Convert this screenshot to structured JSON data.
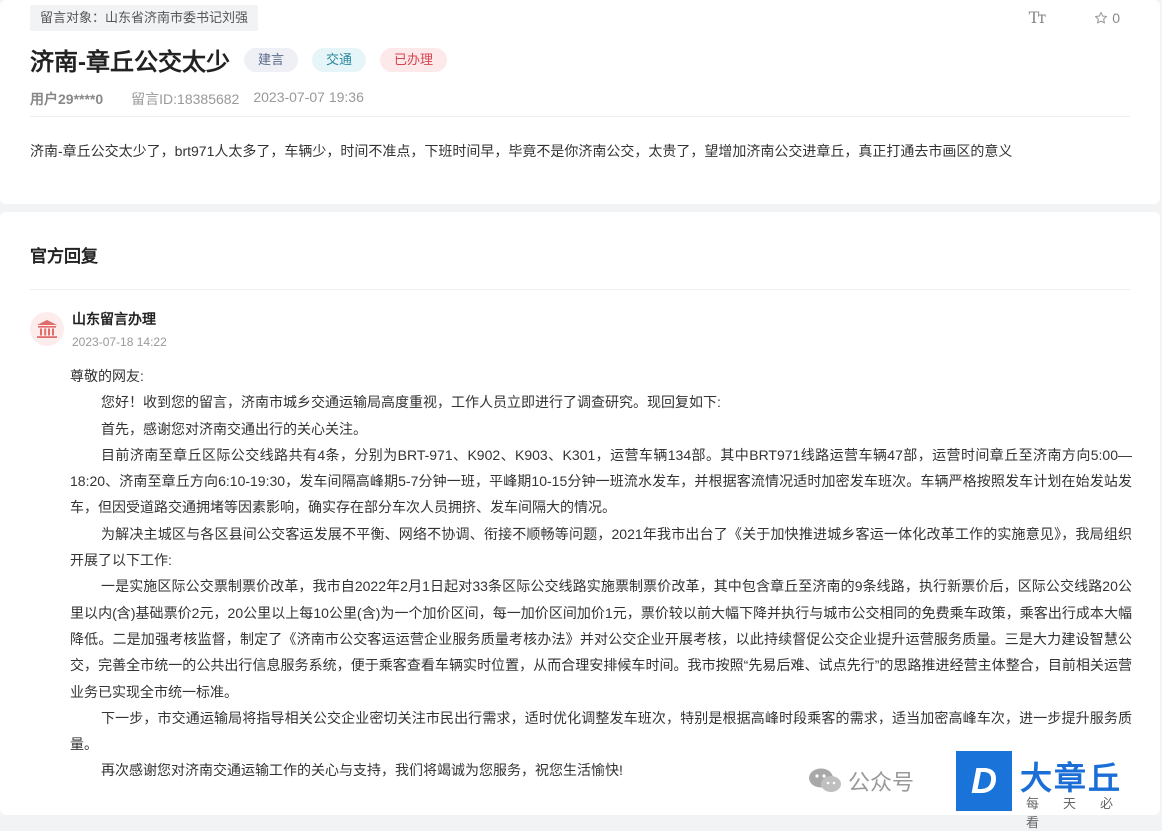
{
  "post": {
    "target": "留言对象：山东省济南市委书记刘强",
    "font_tool": "Tт",
    "like_count": "0",
    "title": "济南-章丘公交太少",
    "tags": [
      "建言",
      "交通",
      "已办理"
    ],
    "user": "用户29****0",
    "post_id": "留言ID:18385682",
    "post_time": "2023-07-07 19:36",
    "content": "济南-章丘公交太少了，brt971人太多了，车辆少，时间不准点，下班时间早，毕竟不是你济南公交，太贵了，望增加济南公交进章丘，真正打通去市画区的意义"
  },
  "reply": {
    "section_title": "官方回复",
    "org_name": "山东留言办理",
    "reply_time": "2023-07-18 14:22",
    "paragraphs": [
      "尊敬的网友:",
      "您好！收到您的留言，济南市城乡交通运输局高度重视，工作人员立即进行了调查研究。现回复如下:",
      "首先，感谢您对济南交通出行的关心关注。",
      "目前济南至章丘区际公交线路共有4条，分别为BRT-971、K902、K903、K301，运营车辆134部。其中BRT971线路运营车辆47部，运营时间章丘至济南方向5:00—18:20、济南至章丘方向6:10-19:30，发车间隔高峰期5-7分钟一班，平峰期10-15分钟一班流水发车，并根据客流情况适时加密发车班次。车辆严格按照发车计划在始发站发车，但因受道路交通拥堵等因素影响，确实存在部分车次人员拥挤、发车间隔大的情况。",
      "为解决主城区与各区县间公交客运发展不平衡、网络不协调、衔接不顺畅等问题，2021年我市出台了《关于加快推进城乡客运一体化改革工作的实施意见》，我局组织开展了以下工作:",
      "一是实施区际公交票制票价改革，我市自2022年2月1日起对33条区际公交线路实施票制票价改革，其中包含章丘至济南的9条线路，执行新票价后，区际公交线路20公里以内(含)基础票价2元，20公里以上每10公里(含)为一个加价区间，每一加价区间加价1元，票价较以前大幅下降并执行与城市公交相同的免费乘车政策，乘客出行成本大幅降低。二是加强考核监督，制定了《济南市公交客运运营企业服务质量考核办法》并对公交企业开展考核，以此持续督促公交企业提升运营服务质量。三是大力建设智慧公交，完善全市统一的公共出行信息服务系统，便于乘客查看车辆实时位置，从而合理安排候车时间。我市按照“先易后难、试点先行”的思路推进经营主体整合，目前相关运营业务已实现全市统一标准。",
      "下一步，市交通运输局将指导相关公交企业密切关注市民出行需求，适时优化调整发车班次，特别是根据高峰时段乘客的需求，适当加密高峰车次，进一步提升服务质量。",
      "再次感谢您对济南交通运输工作的关心与支持，我们将竭诚为您服务，祝您生活愉快!"
    ]
  },
  "watermark": {
    "wechat_text": "公众号",
    "logo_letter": "D",
    "brand": "大章丘",
    "slogan": "每天必看"
  },
  "colors": {
    "brand_blue": "#1a73d9",
    "tag_done": "#d9434e",
    "avatar_red": "#e06c6c"
  }
}
